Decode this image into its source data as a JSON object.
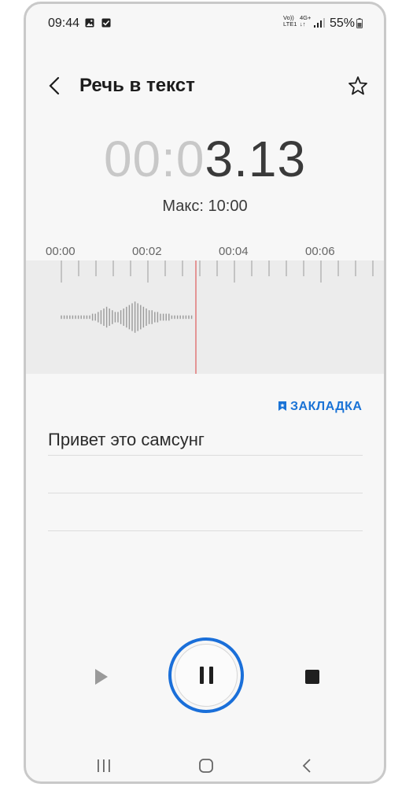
{
  "status": {
    "time": "09:44",
    "volte_line1": "Vo))",
    "volte_line2": "LTE1",
    "net_line1": "4G+",
    "net_line2": "↓↑",
    "battery": "55%"
  },
  "header": {
    "title": "Речь в текст"
  },
  "timer": {
    "dim_part": "00:0",
    "active_part": "3.13",
    "max_label": "Макс: 10:00"
  },
  "timeline": {
    "ticks": [
      "00:00",
      "00:02",
      "00:04",
      "00:06"
    ]
  },
  "bookmark": {
    "label": "ЗАКЛАДКА"
  },
  "transcript": {
    "text": "Привет это самсунг"
  },
  "colors": {
    "accent": "#1a73d6",
    "playhead": "#e07070",
    "pause_ring": "#1a6fd9"
  },
  "icons": {
    "back": "chevron-left-icon",
    "favorite": "star-outline-icon",
    "bookmark": "bookmark-icon",
    "play": "play-icon",
    "pause": "pause-icon",
    "stop": "stop-icon",
    "nav_recent": "recent-apps-icon",
    "nav_home": "home-icon",
    "nav_back": "nav-back-icon"
  }
}
